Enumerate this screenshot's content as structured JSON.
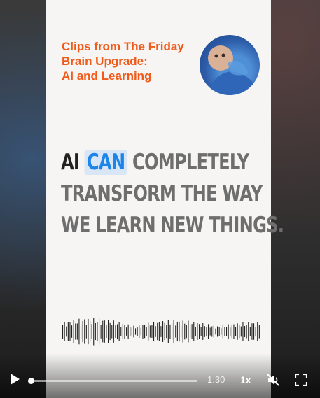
{
  "title_lines": [
    "Clips from The Friday",
    "Brain Upgrade:",
    "AI and Learning"
  ],
  "headline": {
    "line1": [
      {
        "text": "AI",
        "style": "dark"
      },
      {
        "text": "CAN",
        "style": "highlight"
      },
      {
        "text": "COMPLETELY",
        "style": "normal"
      }
    ],
    "line2": "TRANSFORM THE WAY",
    "line3": "WE LEARN NEW THINGS."
  },
  "player": {
    "time": "1:30",
    "speed": "1x",
    "progress": 0.0
  },
  "colors": {
    "title_orange": "#f05a1a",
    "highlight_blue": "#1d84e8",
    "card_bg": "#f6f5f3"
  },
  "icons": [
    "play-icon",
    "mute-icon",
    "fullscreen-icon"
  ]
}
